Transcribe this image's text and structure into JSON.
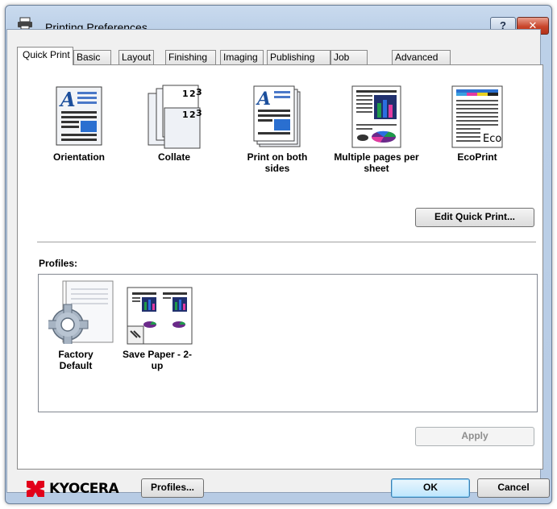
{
  "window": {
    "title": "Printing Preferences"
  },
  "titlebar_buttons": {
    "help": "?",
    "close": "✕"
  },
  "tabs": [
    "Quick Print",
    "Basic",
    "Layout",
    "Finishing",
    "Imaging",
    "Publishing",
    "Job",
    "Advanced"
  ],
  "active_tab": "Quick Print",
  "quick_print": {
    "items": [
      {
        "label": "Orientation",
        "icon": "orientation-icon"
      },
      {
        "label": "Collate",
        "icon": "collate-icon"
      },
      {
        "label": "Print on both sides",
        "icon": "duplex-icon"
      },
      {
        "label": "Multiple pages per sheet",
        "icon": "multiple-pages-icon"
      },
      {
        "label": "EcoPrint",
        "icon": "ecoprint-icon"
      }
    ],
    "collate_numbers": [
      "1",
      "2",
      "3"
    ],
    "eco_badge": "Eco",
    "edit_button": "Edit Quick Print..."
  },
  "profiles": {
    "label": "Profiles:",
    "items": [
      {
        "label": "Factory Default",
        "icon": "gear-document-icon"
      },
      {
        "label": "Save Paper - 2-up",
        "icon": "two-up-document-icon"
      }
    ]
  },
  "apply_button": "Apply",
  "footer": {
    "brand": "KYOCERA",
    "profiles_button": "Profiles...",
    "ok_button": "OK",
    "cancel_button": "Cancel"
  },
  "colors": {
    "kyocera_red": "#e2001a",
    "title_bar": "#bcd0e8",
    "close_red": "#c9452b"
  }
}
